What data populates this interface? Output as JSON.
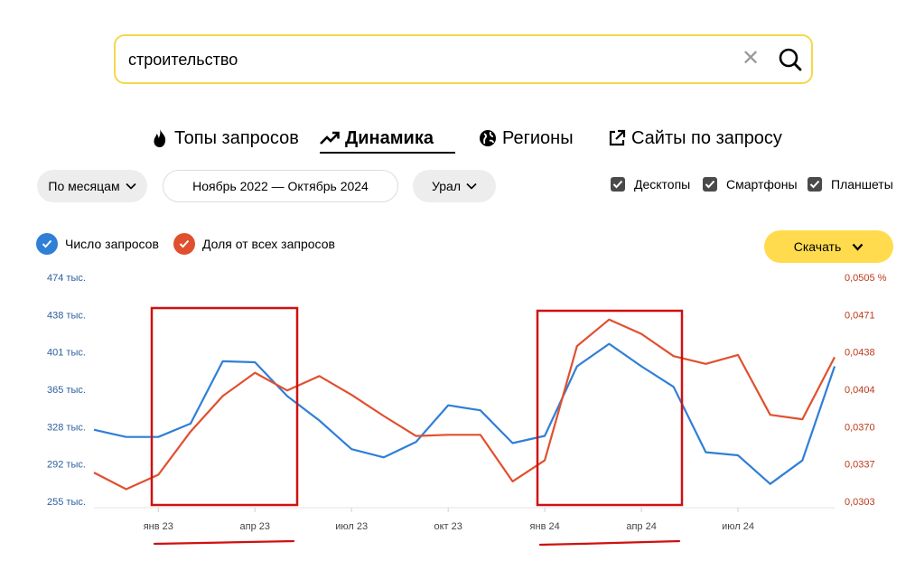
{
  "search": {
    "query": "строительство"
  },
  "tabs": [
    {
      "label": "Топы запросов",
      "icon": "fire-icon",
      "active": false
    },
    {
      "label": "Динамика",
      "icon": "trend-up-icon",
      "active": true
    },
    {
      "label": "Регионы",
      "icon": "globe-icon",
      "active": false
    },
    {
      "label": "Сайты по запросу",
      "icon": "external-link-icon",
      "active": false
    }
  ],
  "filters": {
    "period_mode": "По месяцам",
    "date_range": "Ноябрь 2022 — Октябрь 2024",
    "region": "Урал"
  },
  "devices": [
    {
      "label": "Десктопы",
      "checked": true
    },
    {
      "label": "Смартфоны",
      "checked": true
    },
    {
      "label": "Планшеты",
      "checked": true
    }
  ],
  "legend": {
    "count": "Число запросов",
    "share": "Доля от всех запросов"
  },
  "download_label": "Скачать",
  "colors": {
    "accent_yellow": "#ffdb4d",
    "search_border": "#f5d74c",
    "count_series": "#2f7fd6",
    "share_series": "#e0502f",
    "highlight_box": "#d01010"
  },
  "chart_data": {
    "type": "line",
    "x": [
      "ноя 22",
      "дек 22",
      "янв 23",
      "фев 23",
      "мар 23",
      "апр 23",
      "май 23",
      "июн 23",
      "июл 23",
      "авг 23",
      "сен 23",
      "окт 23",
      "ноя 23",
      "дек 23",
      "янв 24",
      "фев 24",
      "мар 24",
      "апр 24",
      "май 24",
      "июн 24",
      "июл 24",
      "авг 24",
      "сен 24",
      "окт 24"
    ],
    "x_tick_labels": [
      "янв 23",
      "апр 23",
      "июл 23",
      "окт 23",
      "янв 24",
      "апр 24",
      "июл 24"
    ],
    "y_left": {
      "tick_labels": [
        "474 тыс.",
        "438 тыс.",
        "401 тыс.",
        "365 тыс.",
        "328 тыс.",
        "292 тыс.",
        "255 тыс."
      ],
      "ylim": [
        255,
        474
      ]
    },
    "y_right": {
      "tick_labels": [
        "0,0505 %",
        "0,0471",
        "0,0438",
        "0,0404",
        "0,0370",
        "0,0337",
        "0,0303"
      ],
      "ylim": [
        0.0303,
        0.0505
      ]
    },
    "series": [
      {
        "name": "Число запросов",
        "axis": "left",
        "values": [
          325,
          318,
          318,
          331,
          392,
          391,
          358,
          334,
          306,
          298,
          313,
          349,
          344,
          312,
          319,
          387,
          409,
          387,
          367,
          303,
          300,
          272,
          295,
          387
        ]
      },
      {
        "name": "Доля от всех запросов",
        "axis": "right",
        "values": [
          0.0329,
          0.0314,
          0.0327,
          0.0366,
          0.0398,
          0.0419,
          0.0403,
          0.0416,
          0.0399,
          0.038,
          0.0362,
          0.0363,
          0.0363,
          0.0321,
          0.034,
          0.0443,
          0.0467,
          0.0454,
          0.0434,
          0.0427,
          0.0435,
          0.0381,
          0.0377,
          0.0433
        ]
      }
    ],
    "grid": false
  }
}
